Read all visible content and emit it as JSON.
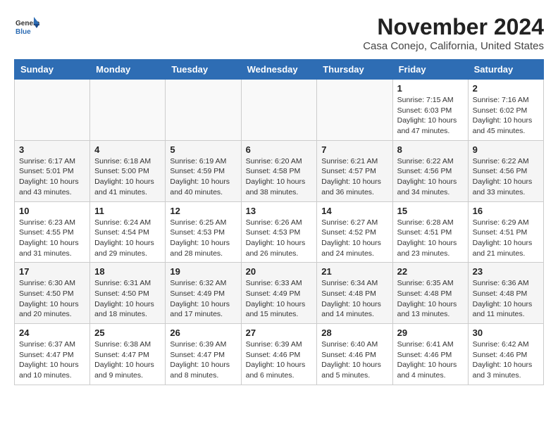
{
  "header": {
    "logo_general": "General",
    "logo_blue": "Blue",
    "month_title": "November 2024",
    "location": "Casa Conejo, California, United States"
  },
  "days_of_week": [
    "Sunday",
    "Monday",
    "Tuesday",
    "Wednesday",
    "Thursday",
    "Friday",
    "Saturday"
  ],
  "weeks": [
    [
      {
        "day": "",
        "info": ""
      },
      {
        "day": "",
        "info": ""
      },
      {
        "day": "",
        "info": ""
      },
      {
        "day": "",
        "info": ""
      },
      {
        "day": "",
        "info": ""
      },
      {
        "day": "1",
        "info": "Sunrise: 7:15 AM\nSunset: 6:03 PM\nDaylight: 10 hours and 47 minutes."
      },
      {
        "day": "2",
        "info": "Sunrise: 7:16 AM\nSunset: 6:02 PM\nDaylight: 10 hours and 45 minutes."
      }
    ],
    [
      {
        "day": "3",
        "info": "Sunrise: 6:17 AM\nSunset: 5:01 PM\nDaylight: 10 hours and 43 minutes."
      },
      {
        "day": "4",
        "info": "Sunrise: 6:18 AM\nSunset: 5:00 PM\nDaylight: 10 hours and 41 minutes."
      },
      {
        "day": "5",
        "info": "Sunrise: 6:19 AM\nSunset: 4:59 PM\nDaylight: 10 hours and 40 minutes."
      },
      {
        "day": "6",
        "info": "Sunrise: 6:20 AM\nSunset: 4:58 PM\nDaylight: 10 hours and 38 minutes."
      },
      {
        "day": "7",
        "info": "Sunrise: 6:21 AM\nSunset: 4:57 PM\nDaylight: 10 hours and 36 minutes."
      },
      {
        "day": "8",
        "info": "Sunrise: 6:22 AM\nSunset: 4:56 PM\nDaylight: 10 hours and 34 minutes."
      },
      {
        "day": "9",
        "info": "Sunrise: 6:22 AM\nSunset: 4:56 PM\nDaylight: 10 hours and 33 minutes."
      }
    ],
    [
      {
        "day": "10",
        "info": "Sunrise: 6:23 AM\nSunset: 4:55 PM\nDaylight: 10 hours and 31 minutes."
      },
      {
        "day": "11",
        "info": "Sunrise: 6:24 AM\nSunset: 4:54 PM\nDaylight: 10 hours and 29 minutes."
      },
      {
        "day": "12",
        "info": "Sunrise: 6:25 AM\nSunset: 4:53 PM\nDaylight: 10 hours and 28 minutes."
      },
      {
        "day": "13",
        "info": "Sunrise: 6:26 AM\nSunset: 4:53 PM\nDaylight: 10 hours and 26 minutes."
      },
      {
        "day": "14",
        "info": "Sunrise: 6:27 AM\nSunset: 4:52 PM\nDaylight: 10 hours and 24 minutes."
      },
      {
        "day": "15",
        "info": "Sunrise: 6:28 AM\nSunset: 4:51 PM\nDaylight: 10 hours and 23 minutes."
      },
      {
        "day": "16",
        "info": "Sunrise: 6:29 AM\nSunset: 4:51 PM\nDaylight: 10 hours and 21 minutes."
      }
    ],
    [
      {
        "day": "17",
        "info": "Sunrise: 6:30 AM\nSunset: 4:50 PM\nDaylight: 10 hours and 20 minutes."
      },
      {
        "day": "18",
        "info": "Sunrise: 6:31 AM\nSunset: 4:50 PM\nDaylight: 10 hours and 18 minutes."
      },
      {
        "day": "19",
        "info": "Sunrise: 6:32 AM\nSunset: 4:49 PM\nDaylight: 10 hours and 17 minutes."
      },
      {
        "day": "20",
        "info": "Sunrise: 6:33 AM\nSunset: 4:49 PM\nDaylight: 10 hours and 15 minutes."
      },
      {
        "day": "21",
        "info": "Sunrise: 6:34 AM\nSunset: 4:48 PM\nDaylight: 10 hours and 14 minutes."
      },
      {
        "day": "22",
        "info": "Sunrise: 6:35 AM\nSunset: 4:48 PM\nDaylight: 10 hours and 13 minutes."
      },
      {
        "day": "23",
        "info": "Sunrise: 6:36 AM\nSunset: 4:48 PM\nDaylight: 10 hours and 11 minutes."
      }
    ],
    [
      {
        "day": "24",
        "info": "Sunrise: 6:37 AM\nSunset: 4:47 PM\nDaylight: 10 hours and 10 minutes."
      },
      {
        "day": "25",
        "info": "Sunrise: 6:38 AM\nSunset: 4:47 PM\nDaylight: 10 hours and 9 minutes."
      },
      {
        "day": "26",
        "info": "Sunrise: 6:39 AM\nSunset: 4:47 PM\nDaylight: 10 hours and 8 minutes."
      },
      {
        "day": "27",
        "info": "Sunrise: 6:39 AM\nSunset: 4:46 PM\nDaylight: 10 hours and 6 minutes."
      },
      {
        "day": "28",
        "info": "Sunrise: 6:40 AM\nSunset: 4:46 PM\nDaylight: 10 hours and 5 minutes."
      },
      {
        "day": "29",
        "info": "Sunrise: 6:41 AM\nSunset: 4:46 PM\nDaylight: 10 hours and 4 minutes."
      },
      {
        "day": "30",
        "info": "Sunrise: 6:42 AM\nSunset: 4:46 PM\nDaylight: 10 hours and 3 minutes."
      }
    ]
  ]
}
